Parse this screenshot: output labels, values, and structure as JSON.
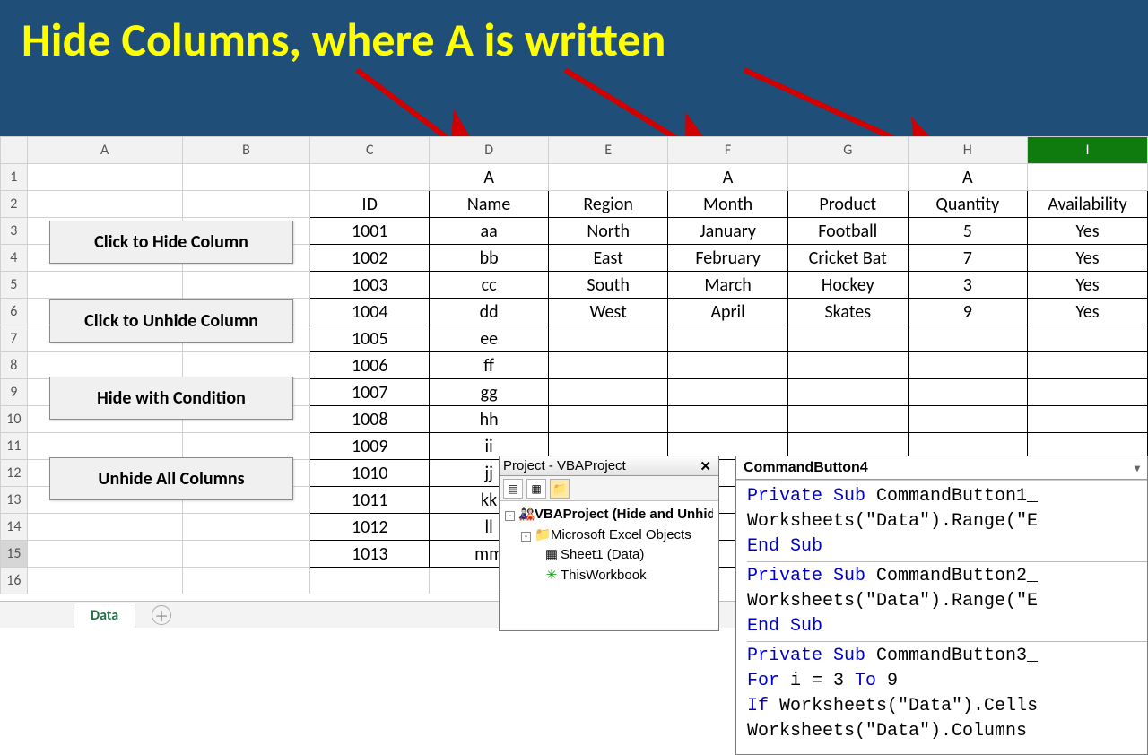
{
  "banner": {
    "title": "Hide Columns, where A is written"
  },
  "columns": [
    "A",
    "B",
    "C",
    "D",
    "E",
    "F",
    "G",
    "H",
    "I"
  ],
  "selected_col_index": 8,
  "selected_row_index": 14,
  "row_numbers": [
    1,
    2,
    3,
    4,
    5,
    6,
    7,
    8,
    9,
    10,
    11,
    12,
    13,
    14,
    15,
    16
  ],
  "markers": {
    "D": "A",
    "F": "A",
    "H": "A"
  },
  "table_headers": [
    "ID",
    "Name",
    "Region",
    "Month",
    "Product",
    "Quantity",
    "Availability"
  ],
  "table_rows": [
    {
      "id": "1001",
      "name": "aa",
      "region": "North",
      "month": "January",
      "product": "Football",
      "quantity": "5",
      "availability": "Yes"
    },
    {
      "id": "1002",
      "name": "bb",
      "region": "East",
      "month": "February",
      "product": "Cricket Bat",
      "quantity": "7",
      "availability": "Yes"
    },
    {
      "id": "1003",
      "name": "cc",
      "region": "South",
      "month": "March",
      "product": "Hockey",
      "quantity": "3",
      "availability": "Yes"
    },
    {
      "id": "1004",
      "name": "dd",
      "region": "West",
      "month": "April",
      "product": "Skates",
      "quantity": "9",
      "availability": "Yes"
    },
    {
      "id": "1005",
      "name": "ee",
      "region": "",
      "month": "",
      "product": "",
      "quantity": "",
      "availability": ""
    },
    {
      "id": "1006",
      "name": "ff",
      "region": "",
      "month": "",
      "product": "",
      "quantity": "",
      "availability": ""
    },
    {
      "id": "1007",
      "name": "gg",
      "region": "",
      "month": "",
      "product": "",
      "quantity": "",
      "availability": ""
    },
    {
      "id": "1008",
      "name": "hh",
      "region": "",
      "month": "",
      "product": "",
      "quantity": "",
      "availability": ""
    },
    {
      "id": "1009",
      "name": "ii",
      "region": "",
      "month": "",
      "product": "",
      "quantity": "",
      "availability": ""
    },
    {
      "id": "1010",
      "name": "jj",
      "region": "",
      "month": "",
      "product": "",
      "quantity": "",
      "availability": ""
    },
    {
      "id": "1011",
      "name": "kk",
      "region": "",
      "month": "",
      "product": "",
      "quantity": "",
      "availability": ""
    },
    {
      "id": "1012",
      "name": "ll",
      "region": "",
      "month": "",
      "product": "",
      "quantity": "",
      "availability": ""
    },
    {
      "id": "1013",
      "name": "mm",
      "region": "",
      "month": "",
      "product": "",
      "quantity": "",
      "availability": ""
    }
  ],
  "buttons": {
    "hide_column": "Click to Hide Column",
    "unhide_column": "Click to Unhide Column",
    "hide_condition": "Hide with Condition",
    "unhide_all": "Unhide All Columns"
  },
  "sheet_tab": "Data",
  "vbe": {
    "explorer_title": "Project - VBAProject",
    "tree": {
      "root": "VBAProject (Hide and Unhide",
      "folder": "Microsoft Excel Objects",
      "sheet": "Sheet1 (Data)",
      "workbook": "ThisWorkbook"
    },
    "code_dropdown": "CommandButton4",
    "code_lines": [
      {
        "t": "Private Sub CommandButton1_",
        "kw": [
          [
            "Private Sub",
            0
          ]
        ]
      },
      {
        "t": "Worksheets(\"Data\").Range(\"E"
      },
      {
        "t": "End Sub",
        "kw": [
          [
            "End Sub",
            0
          ]
        ]
      },
      {
        "div": true
      },
      {
        "t": "Private Sub CommandButton2_",
        "kw": [
          [
            "Private Sub",
            0
          ]
        ]
      },
      {
        "t": "Worksheets(\"Data\").Range(\"E"
      },
      {
        "t": "End Sub",
        "kw": [
          [
            "End Sub",
            0
          ]
        ]
      },
      {
        "div": true
      },
      {
        "t": "Private Sub CommandButton3_",
        "kw": [
          [
            "Private Sub",
            0
          ]
        ]
      },
      {
        "t": "For i = 3 To 9",
        "kw": [
          [
            "For",
            0
          ],
          [
            "To",
            10
          ]
        ]
      },
      {
        "t": "If Worksheets(\"Data\").Cells",
        "kw": [
          [
            "If",
            0
          ]
        ]
      },
      {
        "t": "Worksheets(\"Data\").Columns"
      }
    ]
  }
}
